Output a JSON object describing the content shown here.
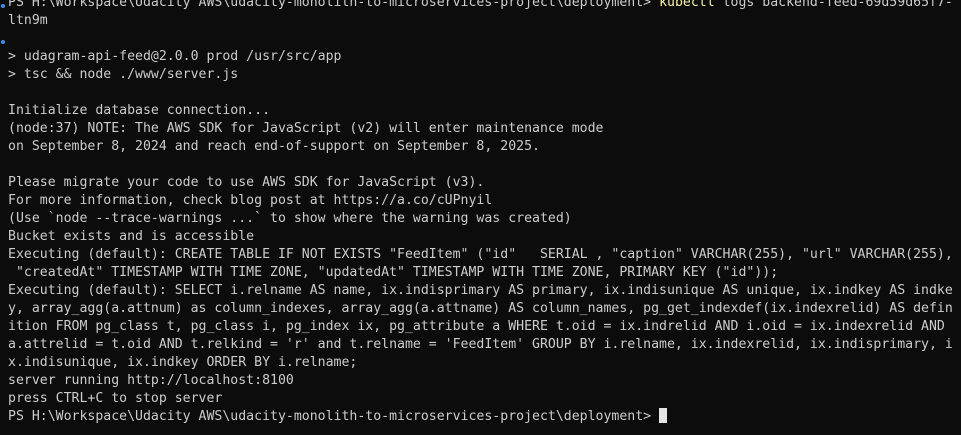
{
  "terminal": {
    "lines": [
      {
        "type": "prompt",
        "prompt": "PS H:\\Workspace\\Udacity AWS\\udacity-monolith-to-microservices-project\\deployment>",
        "command": "kubectl",
        "args": " logs backend-feed-69d59d65f7-"
      },
      {
        "type": "text",
        "text": "ltn9m"
      },
      {
        "type": "text",
        "text": ""
      },
      {
        "type": "text",
        "text": "> udagram-api-feed@2.0.0 prod /usr/src/app"
      },
      {
        "type": "text",
        "text": "> tsc && node ./www/server.js"
      },
      {
        "type": "text",
        "text": ""
      },
      {
        "type": "text",
        "text": "Initialize database connection..."
      },
      {
        "type": "text",
        "text": "(node:37) NOTE: The AWS SDK for JavaScript (v2) will enter maintenance mode"
      },
      {
        "type": "text",
        "text": "on September 8, 2024 and reach end-of-support on September 8, 2025."
      },
      {
        "type": "text",
        "text": ""
      },
      {
        "type": "text",
        "text": "Please migrate your code to use AWS SDK for JavaScript (v3)."
      },
      {
        "type": "text",
        "text": "For more information, check blog post at https://a.co/cUPnyil"
      },
      {
        "type": "text",
        "text": "(Use `node --trace-warnings ...` to show where the warning was created)"
      },
      {
        "type": "text",
        "text": "Bucket exists and is accessible"
      },
      {
        "type": "text",
        "text": "Executing (default): CREATE TABLE IF NOT EXISTS \"FeedItem\" (\"id\"   SERIAL , \"caption\" VARCHAR(255), \"url\" VARCHAR(255),"
      },
      {
        "type": "text",
        "text": " \"createdAt\" TIMESTAMP WITH TIME ZONE, \"updatedAt\" TIMESTAMP WITH TIME ZONE, PRIMARY KEY (\"id\"));"
      },
      {
        "type": "text",
        "text": "Executing (default): SELECT i.relname AS name, ix.indisprimary AS primary, ix.indisunique AS unique, ix.indkey AS indke"
      },
      {
        "type": "text",
        "text": "y, array_agg(a.attnum) as column_indexes, array_agg(a.attname) AS column_names, pg_get_indexdef(ix.indexrelid) AS defin"
      },
      {
        "type": "text",
        "text": "ition FROM pg_class t, pg_class i, pg_index ix, pg_attribute a WHERE t.oid = ix.indrelid AND i.oid = ix.indexrelid AND"
      },
      {
        "type": "text",
        "text": "a.attrelid = t.oid AND t.relkind = 'r' and t.relname = 'FeedItem' GROUP BY i.relname, ix.indexrelid, ix.indisprimary, i"
      },
      {
        "type": "text",
        "text": "x.indisunique, ix.indkey ORDER BY i.relname;"
      },
      {
        "type": "text",
        "text": "server running http://localhost:8100"
      },
      {
        "type": "text",
        "text": "press CTRL+C to stop server"
      },
      {
        "type": "input",
        "prompt": "PS H:\\Workspace\\Udacity AWS\\udacity-monolith-to-microservices-project\\deployment>"
      }
    ]
  },
  "colors": {
    "background": "#0c0c0c",
    "text": "#cccccc",
    "command": "#f9f1a5",
    "marker": "#3b8eea",
    "cursor": "#e5e5e5"
  }
}
